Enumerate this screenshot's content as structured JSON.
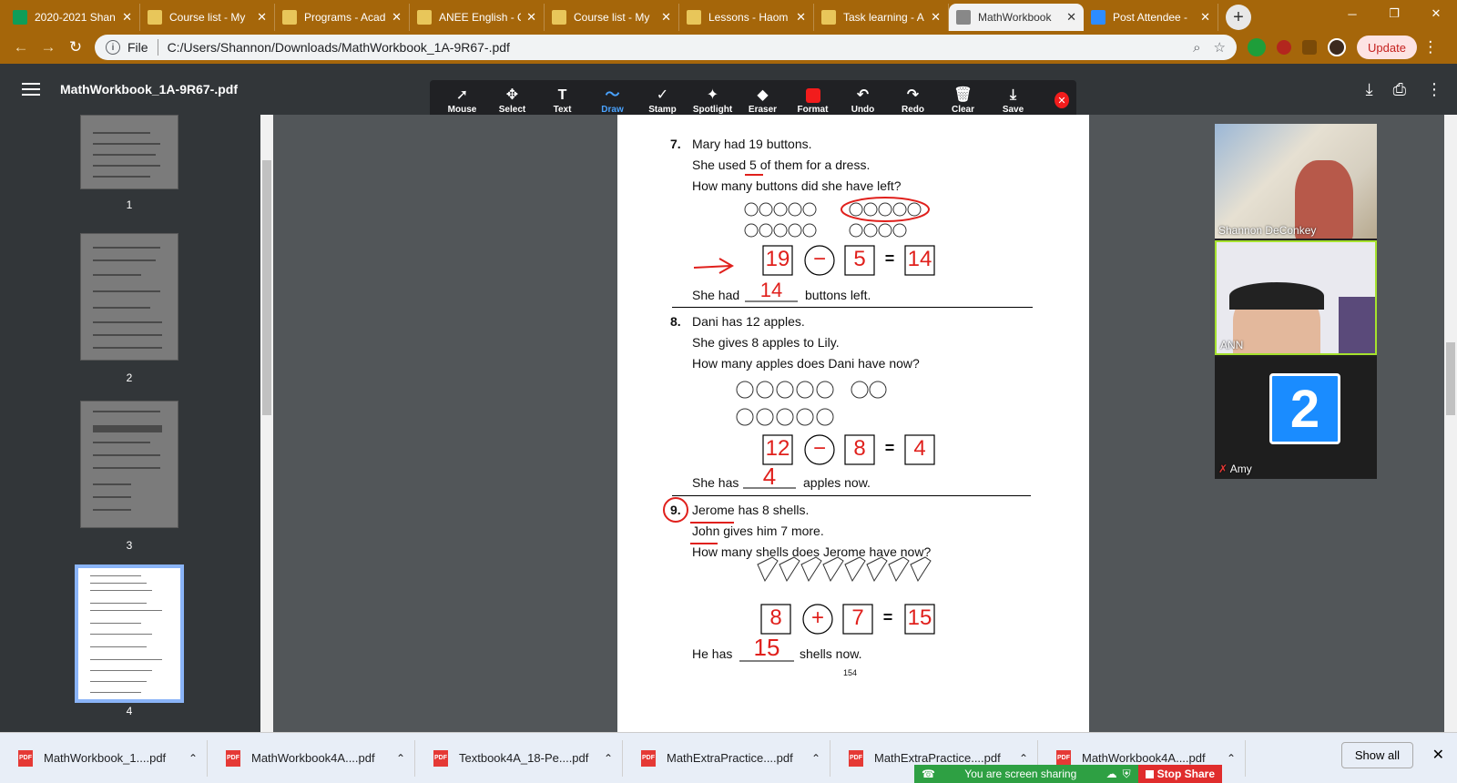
{
  "tabs": [
    {
      "title": "2020-2021 Shan",
      "color": "#0f9d58",
      "active": false
    },
    {
      "title": "Course list - My",
      "color": "#e8c65a",
      "active": false
    },
    {
      "title": "Programs - Acad",
      "color": "#e8c65a",
      "active": false
    },
    {
      "title": "ANEE English - C",
      "color": "#e8c65a",
      "active": false
    },
    {
      "title": "Course list - My",
      "color": "#e8c65a",
      "active": false
    },
    {
      "title": "Lessons - Haom",
      "color": "#e8c65a",
      "active": false
    },
    {
      "title": "Task learning - A",
      "color": "#e8c65a",
      "active": false
    },
    {
      "title": "MathWorkbook",
      "color": "#888888",
      "active": true
    },
    {
      "title": "Post Attendee -",
      "color": "#2d8cff",
      "active": false
    }
  ],
  "address": {
    "scheme_label": "File",
    "url": "C:/Users/Shannon/Downloads/MathWorkbook_1A-9R67-.pdf",
    "update_label": "Update"
  },
  "pdf": {
    "title": "MathWorkbook_1A-9R67-.pdf"
  },
  "toolbar": {
    "tools": [
      {
        "label": "Mouse",
        "glyph": "➚"
      },
      {
        "label": "Select",
        "glyph": "✥"
      },
      {
        "label": "Text",
        "glyph": "T"
      },
      {
        "label": "Draw",
        "glyph": "〜"
      },
      {
        "label": "Stamp",
        "glyph": "✓"
      },
      {
        "label": "Spotlight",
        "glyph": "✦"
      },
      {
        "label": "Eraser",
        "glyph": "◆"
      },
      {
        "label": "Format",
        "glyph": ""
      },
      {
        "label": "Undo",
        "glyph": "↶"
      },
      {
        "label": "Redo",
        "glyph": "↷"
      },
      {
        "label": "Clear",
        "glyph": "🗑"
      },
      {
        "label": "Save",
        "glyph": "⤓"
      }
    ],
    "active": "Draw"
  },
  "thumbnails": [
    "1",
    "2",
    "3",
    "4"
  ],
  "worksheet": {
    "q7": {
      "number": "7.",
      "lines": [
        "Mary had 19 buttons.",
        "She used 5 of them for a dress.",
        "How many buttons did she have left?"
      ],
      "eq": [
        "19",
        "−",
        "5",
        "=",
        "14"
      ],
      "answer_prefix": "She had",
      "answer": "14",
      "answer_suffix": "buttons left."
    },
    "q8": {
      "number": "8.",
      "lines": [
        "Dani has 12 apples.",
        "She gives 8 apples to Lily.",
        "How many apples does Dani have now?"
      ],
      "eq": [
        "12",
        "−",
        "8",
        "=",
        "4"
      ],
      "answer_prefix": "She has",
      "answer": "4",
      "answer_suffix": "apples now."
    },
    "q9": {
      "number": "9.",
      "lines": [
        "Jerome has 8 shells.",
        "John gives him 7 more.",
        "How many shells does Jerome have now?"
      ],
      "eq": [
        "8",
        "+",
        "7",
        "=",
        "15"
      ],
      "answer_prefix": "He has",
      "answer": "15",
      "answer_suffix": "shells now."
    },
    "page_number": "154"
  },
  "participants": [
    {
      "name": "Shannon DeConkey"
    },
    {
      "name": "ANN"
    },
    {
      "name": "Amy",
      "avatar": "2"
    }
  ],
  "downloads": [
    {
      "name": "MathWorkbook_1....pdf"
    },
    {
      "name": "MathWorkbook4A....pdf"
    },
    {
      "name": "Textbook4A_18-Pe....pdf"
    },
    {
      "name": "MathExtraPractice....pdf"
    },
    {
      "name": "MathExtraPractice....pdf"
    },
    {
      "name": "MathWorkbook4A....pdf"
    }
  ],
  "download_bar": {
    "show_all": "Show all",
    "pdf_badge": "PDF"
  },
  "screen_share": {
    "status": "You are screen sharing",
    "stop": "Stop Share"
  },
  "colors": {
    "accent": "#8ab4f8",
    "ink": "#e0201c",
    "chrome": "#a5660a"
  }
}
